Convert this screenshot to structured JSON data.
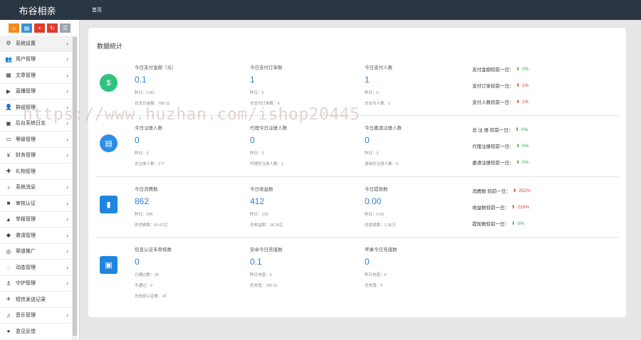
{
  "header": {
    "brand": "布谷相亲",
    "nav_home": "首页"
  },
  "toolbar": {
    "buttons": [
      {
        "icon": "home-icon",
        "color": "#f08b1e",
        "glyph": "⌂"
      },
      {
        "icon": "file-icon",
        "color": "#3b8fd8",
        "glyph": "▤"
      },
      {
        "icon": "trash-icon",
        "color": "#e03b2e",
        "glyph": "▪"
      },
      {
        "icon": "refresh-icon",
        "color": "#e03b2e",
        "glyph": "↻"
      },
      {
        "icon": "list-icon",
        "color": "#9aa3ab",
        "glyph": "☰"
      }
    ]
  },
  "sidebar": {
    "items": [
      {
        "label": "系统设置",
        "icon": "gears-icon",
        "glyph": "⚙",
        "chev": "›"
      },
      {
        "label": "用户管理",
        "icon": "users-icon",
        "glyph": "👥",
        "chev": "›"
      },
      {
        "label": "文章管理",
        "icon": "grid-icon",
        "glyph": "▦",
        "chev": "›"
      },
      {
        "label": "直播管理",
        "icon": "video-icon",
        "glyph": "▶",
        "chev": "›"
      },
      {
        "label": "群组管理",
        "icon": "group-icon",
        "glyph": "👤",
        "chev": "›"
      },
      {
        "label": "后台系统日志",
        "icon": "log-icon",
        "glyph": "▣",
        "chev": "›"
      },
      {
        "label": "等级管理",
        "icon": "monitor-icon",
        "glyph": "▭",
        "chev": "›"
      },
      {
        "label": "财务管理",
        "icon": "yen-icon",
        "glyph": "¥",
        "chev": "›"
      },
      {
        "label": "礼物管理",
        "icon": "gift-icon",
        "glyph": "✚",
        "chev": ""
      },
      {
        "label": "系统消息",
        "icon": "bell-icon",
        "glyph": "♪",
        "chev": "›"
      },
      {
        "label": "审核认证",
        "icon": "camera-icon",
        "glyph": "■",
        "chev": "›"
      },
      {
        "label": "举报管理",
        "icon": "warning-icon",
        "glyph": "▲",
        "chev": "›"
      },
      {
        "label": "邀请管理",
        "icon": "invite-icon",
        "glyph": "◆",
        "chev": "›"
      },
      {
        "label": "渠道推广",
        "icon": "channel-icon",
        "glyph": "◎",
        "chev": "›"
      },
      {
        "label": "动态管理",
        "icon": "bulb-icon",
        "glyph": "◌",
        "chev": "›"
      },
      {
        "label": "守护管理",
        "icon": "anchor-icon",
        "glyph": "⚓",
        "chev": "›"
      },
      {
        "label": "短信发送记录",
        "icon": "plane-icon",
        "glyph": "✈",
        "chev": ""
      },
      {
        "label": "音乐管理",
        "icon": "music-icon",
        "glyph": "♫",
        "chev": "›"
      },
      {
        "label": "意见反馈",
        "icon": "feedback-icon",
        "glyph": "●",
        "chev": ""
      }
    ]
  },
  "main": {
    "title": "数据统计",
    "rows": [
      {
        "icon": "money-icon",
        "glyph": "$",
        "color": "#2ec27e",
        "shape": "circle",
        "stats": [
          {
            "h": "今日支付金额（元）",
            "v": "0.1",
            "s1": "昨日：0.00",
            "s2": "总支付金额：700.11",
            "s3": ""
          },
          {
            "h": "今日支付订单数",
            "v": "1",
            "s1": "昨日：0",
            "s2": "总支付订单数：9",
            "s3": ""
          },
          {
            "h": "今日支付人数",
            "v": "1",
            "s1": "昨日：0",
            "s2": "总支付人数：2",
            "s3": ""
          }
        ],
        "compares": [
          {
            "label": "支付金额较前一日：",
            "dir": "down",
            "arrow": "⬇",
            "pct": "0%"
          },
          {
            "label": "支付订单较前一日：",
            "dir": "up",
            "arrow": "⬆",
            "pct": "1%"
          },
          {
            "label": "支付人数较前一日：",
            "dir": "up",
            "arrow": "⬆",
            "pct": "1%"
          }
        ]
      },
      {
        "icon": "clipboard-icon",
        "glyph": "▤",
        "color": "#2d8ee8",
        "shape": "circle",
        "stats": [
          {
            "h": "今日注册人数",
            "v": "0",
            "s1": "昨日：0",
            "s2": "总注册人数：177",
            "s3": ""
          },
          {
            "h": "代理今日注册人数",
            "v": "0",
            "s1": "昨日：0",
            "s2": "代理总注册人数：1",
            "s3": ""
          },
          {
            "h": "今日邀请注册人数",
            "v": "0",
            "s1": "昨日：0",
            "s2": "邀请总注册人数：6",
            "s3": ""
          }
        ],
        "compares": [
          {
            "label": "总 注 册 较前一日：",
            "dir": "down",
            "arrow": "⬇",
            "pct": "0%"
          },
          {
            "label": "代理注册较前一日：",
            "dir": "down",
            "arrow": "⬇",
            "pct": "0%"
          },
          {
            "label": "邀请注册较前一日：",
            "dir": "down",
            "arrow": "⬇",
            "pct": "0%"
          }
        ]
      },
      {
        "icon": "chat-icon",
        "glyph": "▮",
        "color": "#1f86e0",
        "shape": "square",
        "stats": [
          {
            "h": "今日消费数",
            "v": "862",
            "s1": "昨日：245",
            "s2": "总消费数：61.67亿",
            "s3": ""
          },
          {
            "h": "今日收益数",
            "v": "412",
            "s1": "昨日：133",
            "s2": "总收益数：18.26亿",
            "s3": ""
          },
          {
            "h": "今日提现数",
            "v": "0.00",
            "s1": "昨日：0.00",
            "s2": "总提现数：1.35万",
            "s3": ""
          }
        ],
        "compares": [
          {
            "label": "消费数 较前一日：",
            "dir": "up",
            "arrow": "⬆",
            "pct": "252%"
          },
          {
            "label": "收益数较前一日：",
            "dir": "up",
            "arrow": "⬆",
            "pct": "210%"
          },
          {
            "label": "提现数较前一日：",
            "dir": "down",
            "arrow": "⬇",
            "pct": "0%"
          }
        ]
      },
      {
        "icon": "board-icon",
        "glyph": "▣",
        "color": "#1f86e0",
        "shape": "square",
        "stats": [
          {
            "h": "信息认证未审核数",
            "v": "0",
            "s1": "已通过数：18",
            "s2": "不通过：0",
            "s3": "总信息认证数：18"
          },
          {
            "h": "安卓今日充值数",
            "v": "0.1",
            "s1": "昨日充值：0",
            "s2": "总充值：700.11",
            "s3": ""
          },
          {
            "h": "苹果今日充值数",
            "v": "0",
            "s1": "昨日充值：0",
            "s2": "总充值：0",
            "s3": ""
          }
        ],
        "compares": []
      }
    ]
  },
  "watermark": "https://www.huzhan.com/ishop20445"
}
